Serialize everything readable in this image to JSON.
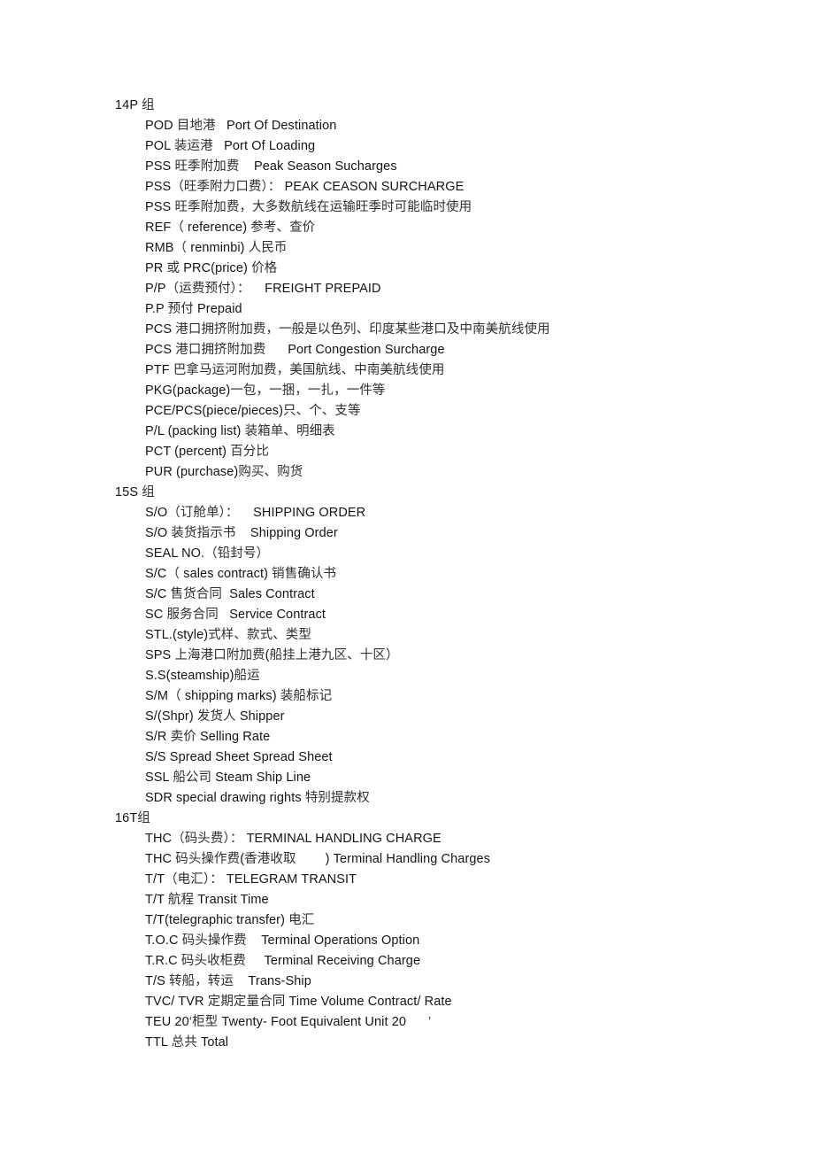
{
  "document": {
    "sections": [
      {
        "heading": "14P 组",
        "entries": [
          "POD 目地港   Port Of Destination",
          "POL 装运港   Port Of Loading",
          "PSS 旺季附加费    Peak Season Sucharges",
          "PSS（旺季附力口费）： PEAK CEASON SURCHARGE",
          "PSS 旺季附加费，大多数航线在运输旺季时可能临时使用",
          "REF（ reference) 参考、查价",
          "RMB（ renminbi) 人民币",
          "PR 或 PRC(price) 价格",
          "P/P（运费预付）：    FREIGHT PREPAID",
          "P.P 预付 Prepaid",
          "PCS 港口拥挤附加费，一般是以色列、印度某些港口及中南美航线使用",
          "PCS 港口拥挤附加费      Port Congestion Surcharge",
          "PTF 巴拿马运河附加费，美国航线、中南美航线使用",
          "PKG(package)一包，一捆，一扎，一件等",
          "PCE/PCS(piece/pieces)只、个、支等",
          "P/L (packing list) 装箱单、明细表",
          "PCT (percent) 百分比",
          "PUR (purchase)购买、购货"
        ]
      },
      {
        "heading": "15S 组",
        "entries": [
          "S/O（订舱单）：    SHIPPING ORDER",
          "S/O 装货指示书    Shipping Order",
          "SEAL NO.（铅封号）",
          "S/C（ sales contract) 销售确认书",
          "S/C 售货合同  Sales Contract",
          "SC 服务合同   Service Contract",
          "STL.(style)式样、款式、类型",
          "SPS 上海港口附加费(船挂上港九区、十区）",
          "S.S(steamship)船运",
          "S/M（ shipping marks) 装船标记",
          "S/(Shpr) 发货人 Shipper",
          "S/R 卖价 Selling Rate",
          "S/S Spread Sheet Spread Sheet",
          "SSL 船公司 Steam Ship Line",
          "SDR special drawing rights 特别提款权"
        ]
      },
      {
        "heading": "16T组",
        "entries": [
          "THC（码头费）： TERMINAL HANDLING CHARGE",
          "THC 码头操作费(香港收取        ) Terminal Handling Charges",
          "T/T（电汇）： TELEGRAM TRANSIT",
          "T/T 航程 Transit Time",
          "T/T(telegraphic transfer) 电汇",
          "T.O.C 码头操作费    Terminal Operations Option",
          "T.R.C 码头收柜费     Terminal Receiving Charge",
          "T/S 转船，转运    Trans-Ship",
          "TVC/ TVR 定期定量合同 Time Volume Contract/ Rate",
          "TEU 20‘柜型 Twenty- Foot Equivalent Unit 20      ’",
          "TTL 总共 Total"
        ]
      }
    ]
  }
}
